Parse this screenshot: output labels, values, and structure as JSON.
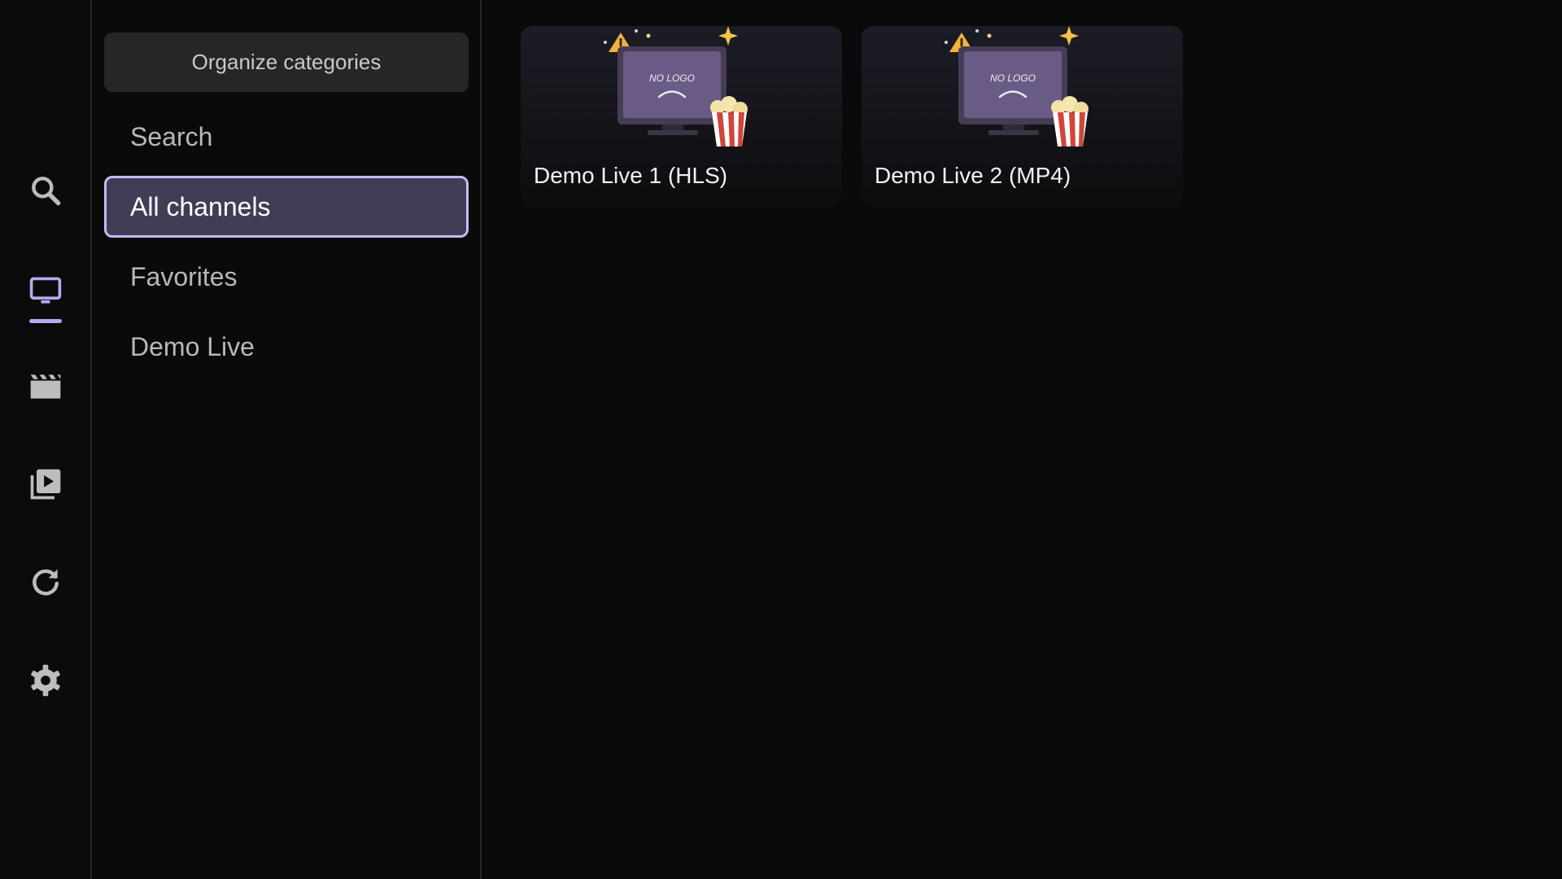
{
  "colors": {
    "accent": "#c8b8f4",
    "selected_bg": "#433c56",
    "icon_default": "#bdbdbd",
    "icon_active": "#b9a8ee"
  },
  "rail": {
    "items": [
      {
        "icon": "search-icon",
        "active": false
      },
      {
        "icon": "tv-icon",
        "active": true
      },
      {
        "icon": "movie-clapper-icon",
        "active": false
      },
      {
        "icon": "video-library-icon",
        "active": false
      },
      {
        "icon": "refresh-icon",
        "active": false
      },
      {
        "icon": "settings-gear-icon",
        "active": false
      }
    ]
  },
  "categories": {
    "organize_label": "Organize categories",
    "items": [
      {
        "label": "Search",
        "selected": false
      },
      {
        "label": "All channels",
        "selected": true
      },
      {
        "label": "Favorites",
        "selected": false
      },
      {
        "label": "Demo Live",
        "selected": false
      }
    ]
  },
  "channels": [
    {
      "title": "Demo Live 1 (HLS)",
      "logo_text": "NO LOGO"
    },
    {
      "title": "Demo Live 2 (MP4)",
      "logo_text": "NO LOGO"
    }
  ]
}
